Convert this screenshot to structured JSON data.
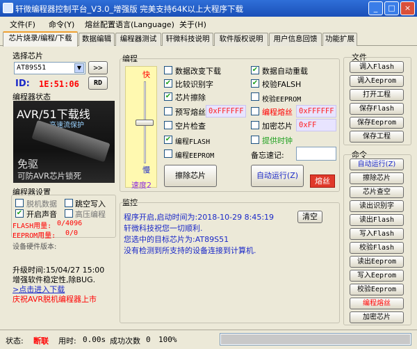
{
  "window": {
    "title": "轩微编程器控制平台_V3.0_增强版 完美支持64K以上大程序下载",
    "minimize": "_",
    "maximize": "□",
    "close": "×"
  },
  "menu": [
    "文件(F)",
    "命令(Y)",
    "熔丝配置语言(Language)",
    "关于(H)"
  ],
  "tabs": [
    "芯片烧录/编程/下载",
    "数据编辑",
    "编程器测试",
    "轩微科技说明",
    "软件版权说明",
    "用户信息回馈",
    "功能扩展"
  ],
  "chip": {
    "header": "选择芯片",
    "selected": "AT89S51",
    "next_btn": ">>",
    "id_label": "ID:",
    "id_value": "1E:51:06",
    "rd_btn": "RD"
  },
  "programmer_status": {
    "header": "编程器状态",
    "img_title": "AVR/51下载线",
    "img_sub": "高速流保护",
    "img_text1": "免驱",
    "img_text2": "可防AVR芯片锁死"
  },
  "programmer_settings": {
    "header": "编程器设置",
    "opt1": "脱机数据",
    "opt2": "跳空写入",
    "opt3": "开启声音",
    "opt4": "高压编程",
    "flash_label": "FLASH用量:",
    "flash_value": "0/4096",
    "eeprom_label": "EEPROM用量:",
    "eeprom_value": "0/0",
    "version_label": "设备硬件版本:"
  },
  "upgrade": {
    "time": "升级时间:15/04/27 15:00",
    "note": "增强软件稳定性,除BUG.",
    "link": ">点击进入下载",
    "celebrate": "庆祝AVR脱机编程器上市"
  },
  "programming": {
    "header": "编程",
    "fast": "快",
    "slow": "慢",
    "speed": "速度2",
    "speed_level": 0.5,
    "opts_left": [
      {
        "label": "数据改变下载",
        "checked": false
      },
      {
        "label": "比较识别字",
        "checked": true
      },
      {
        "label": "芯片擦除",
        "checked": true
      },
      {
        "label": "预写熔丝",
        "checked": false
      },
      {
        "label": "空片检查",
        "checked": false
      },
      {
        "label": "编程FLASH",
        "checked": true
      },
      {
        "label": "编程EEPROM",
        "checked": false
      }
    ],
    "opts_right": [
      {
        "label": "数据自动重载",
        "checked": true
      },
      {
        "label": "校验FALSH",
        "checked": true
      },
      {
        "label": "校验EEPROM",
        "checked": false
      },
      {
        "label": "编程熔丝",
        "checked": false
      },
      {
        "label": "加密芯片",
        "checked": false
      },
      {
        "label": "提供时钟",
        "checked": false
      }
    ],
    "prewrite_fuse": "0xFFFFFF",
    "prog_fuse": "0xFFFFFF",
    "encrypt": "0xFF",
    "memo_label": "备忘速记:",
    "memo_value": "",
    "erase_btn": "擦除芯片",
    "auto_btn": "自动运行(Z)",
    "fuse_btn": "熔丝"
  },
  "monitor": {
    "header": "监控",
    "clear_btn": "清空",
    "lines": [
      "程序开启,启动时间为:2018-10-29 8:45:19",
      "轩微科技祝您一切顺利.",
      "您选中的目标芯片为:AT89S51",
      "没有检测到所支持的设备连接到计算机."
    ]
  },
  "file": {
    "header": "文件",
    "buttons": [
      "调入Flash",
      "调入Eeprom",
      "打开工程",
      "保存Flash",
      "保存Eeprom",
      "保存工程"
    ]
  },
  "command": {
    "header": "命令",
    "buttons": [
      "自动运行(Z)",
      "擦除芯片",
      "芯片查空",
      "读出识别字",
      "读出Flash",
      "写入Flash",
      "校验Flash",
      "读出Eeprom",
      "写入Eeprom",
      "校验Eeprom",
      "编程熔丝",
      "加密芯片"
    ]
  },
  "status": {
    "state_label": "状态:",
    "state_value": "断联",
    "time_label": "用时:",
    "time_value": "0.00s",
    "success_label": "成功次数",
    "success_value": "0",
    "progress": "100%",
    "progress_value": 1.0
  },
  "colors": {
    "title": "#1a4fb8",
    "accent": "#f0a030",
    "red": "#ff0000",
    "link": "#1a28c8"
  }
}
